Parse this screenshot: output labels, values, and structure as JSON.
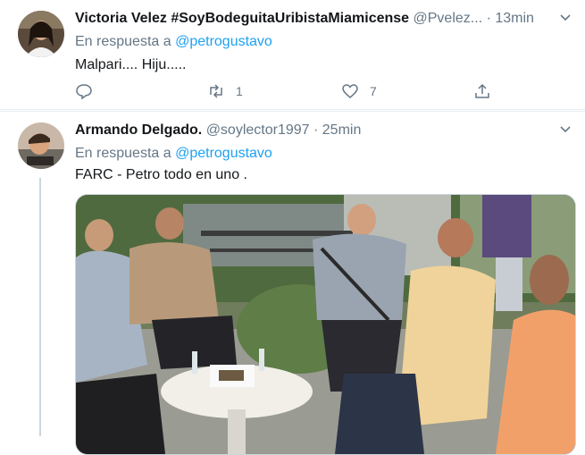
{
  "tweets": [
    {
      "display_name": "Victoria Velez #SoyBodeguitaUribistaMiamicense",
      "handle": "@Pvelez...",
      "dot": "·",
      "time": "13min",
      "reply_prefix": "En respuesta a",
      "reply_to": "@petrogustavo",
      "text": "Malpari.... Hiju.....",
      "retweets": "1",
      "likes": "7"
    },
    {
      "display_name": "Armando Delgado.",
      "handle": "@soylector1997",
      "dot": "·",
      "time": "25min",
      "reply_prefix": "En respuesta a",
      "reply_to": "@petrogustavo",
      "text": "FARC - Petro todo en uno ."
    }
  ],
  "colors": {
    "accent": "#1da1f2",
    "secondary_text": "#657786",
    "divider": "#e6ecf0"
  },
  "icons": [
    "chevron-down-icon",
    "reply-icon",
    "retweet-icon",
    "like-icon",
    "share-icon"
  ]
}
